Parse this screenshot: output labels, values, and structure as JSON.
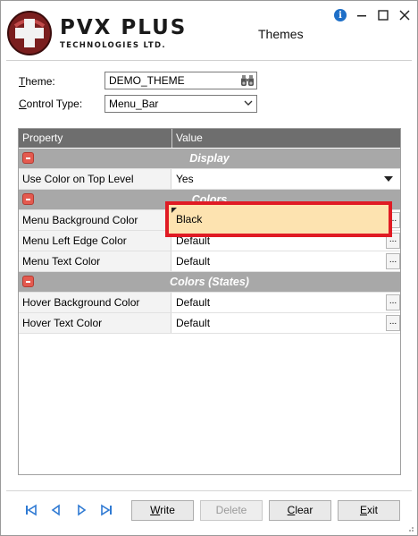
{
  "app": {
    "brand_name": "PVX PLUS",
    "brand_sub": "TECHNOLOGIES LTD.",
    "window_title": "Themes"
  },
  "form": {
    "theme_label_first": "T",
    "theme_label_rest": "heme:",
    "theme_value": "DEMO_THEME",
    "control_label_first": "C",
    "control_label_rest": "ontrol Type:",
    "control_value": "Menu_Bar"
  },
  "grid": {
    "columns": [
      "Property",
      "Value"
    ],
    "sections": [
      {
        "title": "Display",
        "rows": [
          {
            "property": "Use Color on Top Level",
            "value": "Yes"
          }
        ]
      },
      {
        "title": "Colors",
        "rows": [
          {
            "property": "Menu Background Color",
            "value": "Black"
          },
          {
            "property": "Menu Left Edge Color",
            "value": "Default"
          },
          {
            "property": "Menu Text Color",
            "value": "Default"
          }
        ]
      },
      {
        "title": "Colors (States)",
        "rows": [
          {
            "property": "Hover Background Color",
            "value": "Default"
          },
          {
            "property": "Hover Text Color",
            "value": "Default"
          }
        ]
      }
    ],
    "ellipsis": "..."
  },
  "buttons": {
    "write_first": "W",
    "write_rest": "rite",
    "delete": "Delete",
    "clear_first": "C",
    "clear_rest": "lear",
    "exit_first": "E",
    "exit_rest": "xit"
  },
  "colors": {
    "highlight_border": "#e01b24",
    "highlight_fill": "#fde3b0",
    "header_bg": "#6e6e6e",
    "section_bg": "#a8a8a8",
    "nav_blue": "#2f7ad3"
  }
}
